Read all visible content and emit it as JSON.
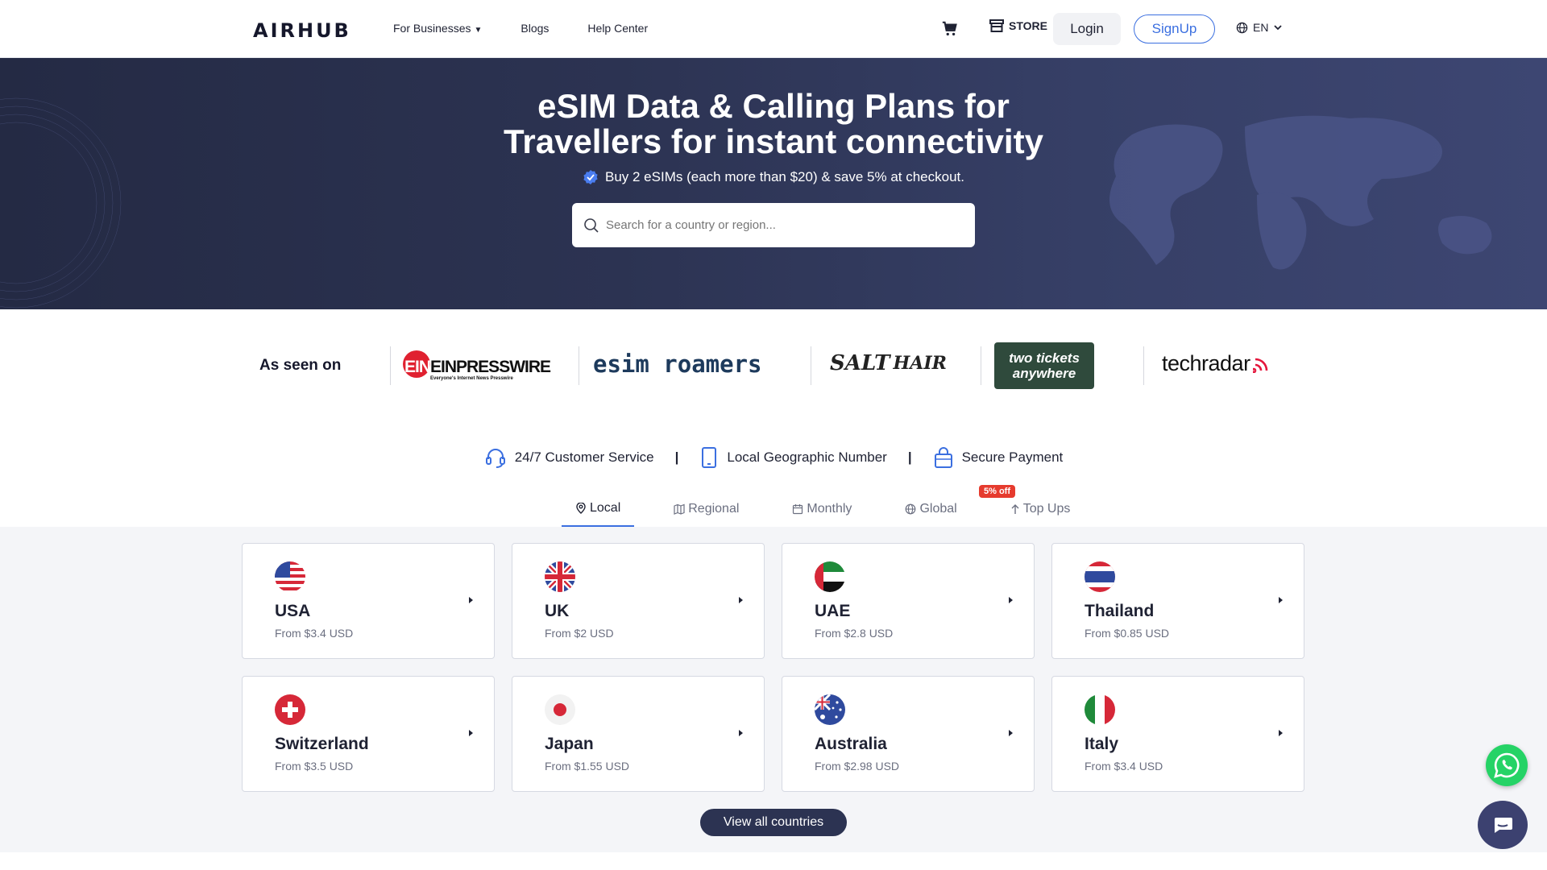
{
  "header": {
    "logo": "AIRHUB",
    "nav": [
      {
        "label": "For Businesses"
      },
      {
        "label": "Blogs"
      },
      {
        "label": "Help Center"
      }
    ],
    "store_label": "STORE",
    "login_label": "Login",
    "signup_label": "SignUp",
    "language": "EN"
  },
  "hero": {
    "title_line1": "eSIM Data & Calling Plans for",
    "title_line2": "Travellers for instant connectivity",
    "promo": "Buy 2 eSIMs (each more than $20) & save 5% at checkout.",
    "search_placeholder": "Search for a country or region..."
  },
  "seen_on": {
    "label": "As seen on",
    "brands": [
      "EINPRESSWIRE",
      "Everyone's Internet News Presswire",
      "esim roamers",
      "SALT",
      "HAIR",
      "two tickets anywhere",
      "techradar"
    ]
  },
  "features": [
    {
      "label": "24/7 Customer Service"
    },
    {
      "label": "Local Geographic Number"
    },
    {
      "label": "Secure Payment"
    }
  ],
  "features_separator": "|",
  "tabs": [
    {
      "label": "Local"
    },
    {
      "label": "Regional"
    },
    {
      "label": "Monthly"
    },
    {
      "label": "Global"
    },
    {
      "label": "Top Ups"
    }
  ],
  "topups_badge": "5% off",
  "countries": [
    {
      "name": "USA",
      "price": "From $3.4 USD"
    },
    {
      "name": "UK",
      "price": "From $2 USD"
    },
    {
      "name": "UAE",
      "price": "From $2.8 USD"
    },
    {
      "name": "Thailand",
      "price": "From $0.85 USD"
    },
    {
      "name": "Switzerland",
      "price": "From $3.5 USD"
    },
    {
      "name": "Japan",
      "price": "From $1.55 USD"
    },
    {
      "name": "Australia",
      "price": "From $2.98 USD"
    },
    {
      "name": "Italy",
      "price": "From $3.4 USD"
    }
  ],
  "view_all_label": "View all countries",
  "colors": {
    "accent": "#3b6fe0",
    "hero_dark": "#242a44",
    "badge": "#e63b2e",
    "whatsapp": "#25d366"
  }
}
